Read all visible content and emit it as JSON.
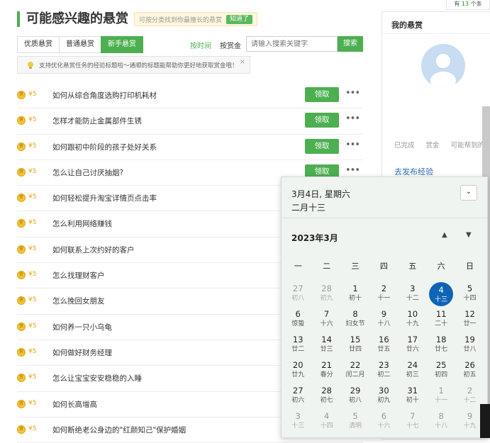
{
  "badge": {
    "prefix": "有",
    "count": "13",
    "suffix": "个条"
  },
  "header": {
    "title": "可能感兴趣的悬赏",
    "tip": "可按分类找到你最擅长的悬赏",
    "tip_button": "知道了"
  },
  "tabs": [
    {
      "label": "优质悬赏",
      "active": false
    },
    {
      "label": "普通悬赏",
      "active": false
    },
    {
      "label": "新手悬赏",
      "active": true
    }
  ],
  "sort": {
    "by_time": "按时间",
    "by_reward": "按赏金"
  },
  "search": {
    "placeholder": "请输入搜索关键字",
    "button": "搜索"
  },
  "notice": {
    "text": "支持优化悬赏任务的经验标题啦～通顺的标题能帮助你更好地获取赏金哦！",
    "close": "×"
  },
  "rows": [
    {
      "amount": "¥5",
      "question": "如何从综合角度选购打印机耗材",
      "claim": "领取"
    },
    {
      "amount": "¥5",
      "question": "怎样才能防止金属部件生锈",
      "claim": "领取"
    },
    {
      "amount": "¥5",
      "question": "如何跟初中阶段的孩子处好关系",
      "claim": "领取"
    },
    {
      "amount": "¥5",
      "question": "怎么让自己讨厌抽烟?",
      "claim": "领取"
    },
    {
      "amount": "¥5",
      "question": "如何轻松提升淘宝详情页点击率",
      "claim": ""
    },
    {
      "amount": "¥5",
      "question": "怎么利用网络赚钱",
      "claim": ""
    },
    {
      "amount": "¥5",
      "question": "如何联系上次约好的客户",
      "claim": ""
    },
    {
      "amount": "¥5",
      "question": "怎么找理财客户",
      "claim": ""
    },
    {
      "amount": "¥5",
      "question": "怎么挽回女朋友",
      "claim": ""
    },
    {
      "amount": "¥5",
      "question": "如何养一只小乌龟",
      "claim": ""
    },
    {
      "amount": "¥5",
      "question": "如何做好财务经理",
      "claim": ""
    },
    {
      "amount": "¥5",
      "question": "怎么让宝宝安安稳稳的入睡",
      "claim": ""
    },
    {
      "amount": "¥5",
      "question": "如何长高增高",
      "claim": ""
    },
    {
      "amount": "¥5",
      "question": "如何断绝老公身边的\"红颜知己\"保护婚姻",
      "claim": ""
    }
  ],
  "sidebar": {
    "title": "我的悬赏",
    "stats": [
      "已完成",
      "赏金",
      "可能帮到的"
    ],
    "link": "去发布经验"
  },
  "calendar": {
    "date_line": "3月4日, 星期六",
    "lunar_line": "二月十三",
    "month": "2023年3月",
    "weekdays": [
      "一",
      "二",
      "三",
      "四",
      "五",
      "六",
      "日"
    ],
    "days": [
      {
        "d": "27",
        "l": "初八",
        "dim": true
      },
      {
        "d": "28",
        "l": "初九",
        "dim": true
      },
      {
        "d": "1",
        "l": "初十"
      },
      {
        "d": "2",
        "l": "十一"
      },
      {
        "d": "3",
        "l": "十二"
      },
      {
        "d": "4",
        "l": "十三",
        "today": true
      },
      {
        "d": "5",
        "l": "十四"
      },
      {
        "d": "6",
        "l": "惊蛰"
      },
      {
        "d": "7",
        "l": "十六"
      },
      {
        "d": "8",
        "l": "妇女节"
      },
      {
        "d": "9",
        "l": "十八"
      },
      {
        "d": "10",
        "l": "十九"
      },
      {
        "d": "11",
        "l": "二十"
      },
      {
        "d": "12",
        "l": "廿一"
      },
      {
        "d": "13",
        "l": "廿二"
      },
      {
        "d": "14",
        "l": "廿三"
      },
      {
        "d": "15",
        "l": "廿四"
      },
      {
        "d": "16",
        "l": "廿五"
      },
      {
        "d": "17",
        "l": "廿六"
      },
      {
        "d": "18",
        "l": "廿七"
      },
      {
        "d": "19",
        "l": "廿八"
      },
      {
        "d": "20",
        "l": "廿九"
      },
      {
        "d": "21",
        "l": "春分"
      },
      {
        "d": "22",
        "l": "闰二月"
      },
      {
        "d": "23",
        "l": "初二"
      },
      {
        "d": "24",
        "l": "初三"
      },
      {
        "d": "25",
        "l": "初四"
      },
      {
        "d": "26",
        "l": "初五"
      },
      {
        "d": "27",
        "l": "初六"
      },
      {
        "d": "28",
        "l": "初七"
      },
      {
        "d": "29",
        "l": "初八"
      },
      {
        "d": "30",
        "l": "初九"
      },
      {
        "d": "31",
        "l": "初十"
      },
      {
        "d": "1",
        "l": "十一",
        "dim": true
      },
      {
        "d": "2",
        "l": "十二",
        "dim": true
      },
      {
        "d": "3",
        "l": "十三",
        "dim": true
      },
      {
        "d": "4",
        "l": "十四",
        "dim": true
      },
      {
        "d": "5",
        "l": "清明",
        "dim": true
      },
      {
        "d": "6",
        "l": "十六",
        "dim": true
      },
      {
        "d": "7",
        "l": "十七",
        "dim": true
      },
      {
        "d": "8",
        "l": "十八",
        "dim": true
      },
      {
        "d": "9",
        "l": "十九",
        "dim": true
      }
    ]
  }
}
